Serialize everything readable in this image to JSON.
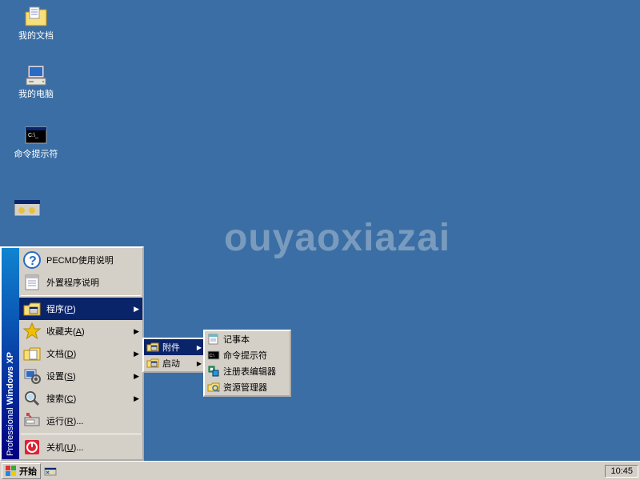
{
  "desktop": {
    "icons": [
      {
        "label": "我的文档"
      },
      {
        "label": "我的电脑"
      },
      {
        "label": "命令提示符"
      }
    ]
  },
  "watermark": "ouyaoxiazai",
  "start_menu": {
    "banner_bold": "Windows XP",
    "banner_light": "Professional",
    "items_top": [
      {
        "label": "PECMD使用说明"
      },
      {
        "label": "外置程序说明"
      }
    ],
    "items_mid": [
      {
        "label": "程序",
        "hotkey": "P",
        "selected": true,
        "arrow": true
      },
      {
        "label": "收藏夹",
        "hotkey": "A",
        "arrow": true
      },
      {
        "label": "文档",
        "hotkey": "D",
        "arrow": true
      },
      {
        "label": "设置",
        "hotkey": "S",
        "arrow": true
      },
      {
        "label": "搜索",
        "hotkey": "C",
        "arrow": true
      },
      {
        "label": "运行",
        "hotkey": "R",
        "suffix": "..."
      }
    ],
    "items_bot": [
      {
        "label": "关机",
        "hotkey": "U",
        "suffix": "..."
      }
    ]
  },
  "submenu1": {
    "items": [
      {
        "label": "附件",
        "selected": true,
        "arrow": true
      },
      {
        "label": "启动",
        "arrow": true
      }
    ]
  },
  "submenu2": {
    "items": [
      {
        "label": "记事本"
      },
      {
        "label": "命令提示符"
      },
      {
        "label": "注册表编辑器"
      },
      {
        "label": "资源管理器"
      }
    ]
  },
  "taskbar": {
    "start": "开始",
    "clock": "10:45"
  }
}
